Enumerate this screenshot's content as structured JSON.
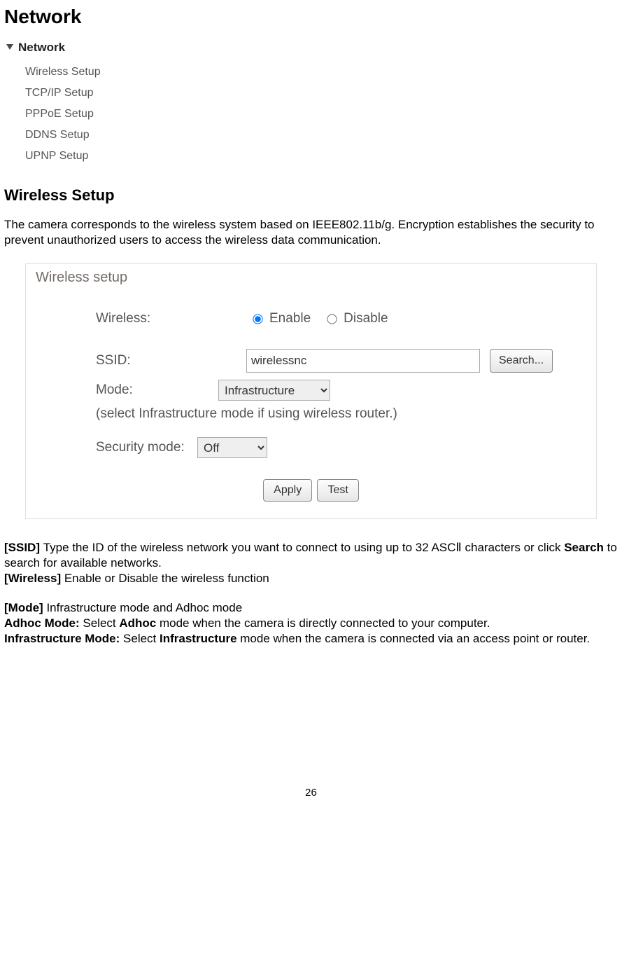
{
  "page_title": "Network",
  "nav": {
    "header": "Network",
    "items": [
      "Wireless Setup",
      "TCP/IP Setup",
      "PPPoE Setup",
      "DDNS Setup",
      "UPNP Setup"
    ]
  },
  "section_heading": "Wireless Setup",
  "intro": "The camera corresponds to the wireless system based on IEEE802.11b/g. Encryption establishes the security to prevent unauthorized users to access the wireless data communication.",
  "form": {
    "title": "Wireless setup",
    "wireless_label": "Wireless:",
    "enable_label": "Enable",
    "disable_label": "Disable",
    "ssid_label": "SSID:",
    "ssid_value": "wirelessnc",
    "search_label": "Search...",
    "mode_label": "Mode:",
    "mode_value": "Infrastructure",
    "mode_hint": "(select Infrastructure mode if using wireless router.)",
    "security_label": "Security mode:",
    "security_value": "Off",
    "apply_label": "Apply",
    "test_label": "Test"
  },
  "descr": {
    "ssid_tag": "[SSID] ",
    "ssid_text_a": "Type the ID of the wireless network you want to connect to using up to 32 ASCⅡ characters or click ",
    "ssid_bold": "Search",
    "ssid_text_b": " to search for available networks.",
    "wireless_tag": "[Wireless] ",
    "wireless_text": "Enable or Disable the wireless function",
    "mode_tag": "[Mode] ",
    "mode_text": "Infrastructure mode and Adhoc mode",
    "adhoc_tag": "Adhoc Mode: ",
    "adhoc_a": "Select ",
    "adhoc_bold": "Adhoc",
    "adhoc_b": " mode when the camera is directly connected to your computer.",
    "infra_tag": "Infrastructure Mode: ",
    "infra_a": "Select ",
    "infra_bold": "Infrastructure",
    "infra_b": " mode when the camera is connected via an access point or router."
  },
  "page_number": "26"
}
